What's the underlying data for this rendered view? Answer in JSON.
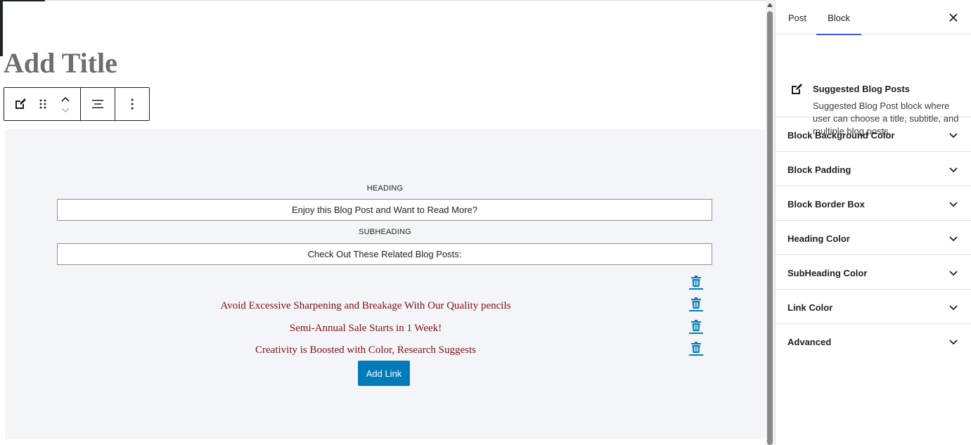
{
  "editor": {
    "title_placeholder": "Add Title"
  },
  "toolbar": {
    "block_type_icon": "edit-square-icon",
    "drag_icon": "drag-handle-icon",
    "move_up_icon": "chevron-up-icon",
    "move_down_icon": "chevron-down-icon",
    "align_icon": "align-center-icon",
    "more_icon": "more-vertical-icon"
  },
  "block": {
    "heading_label": "HEADING",
    "heading_value": "Enjoy this Blog Post and Want to Read More?",
    "subheading_label": "SUBHEADING",
    "subheading_value": "Check Out These Related Blog Posts:",
    "links": [
      {
        "text": ""
      },
      {
        "text": "Avoid Excessive Sharpening and Breakage With Our Quality pencils"
      },
      {
        "text": "Semi-Annual Sale Starts in 1 Week!"
      },
      {
        "text": "Creativity is Boosted with Color, Research Suggests"
      }
    ],
    "add_link_label": "Add Link",
    "colors": {
      "background": "#f4f5f9",
      "link": "#7b1113",
      "accent": "#007cba"
    }
  },
  "sidebar": {
    "tabs": [
      {
        "label": "Post"
      },
      {
        "label": "Block",
        "active": true
      }
    ],
    "block_card": {
      "title": "Suggested Blog Posts",
      "description": "Suggested Blog Post block where user can choose a title, subtitle, and multiple blog posts."
    },
    "panels": [
      {
        "label": "Block Background Color"
      },
      {
        "label": "Block Padding"
      },
      {
        "label": "Block Border Box"
      },
      {
        "label": "Heading Color"
      },
      {
        "label": "SubHeading Color"
      },
      {
        "label": "Link Color"
      },
      {
        "label": "Advanced"
      }
    ],
    "accent_color": "#3858e9"
  }
}
